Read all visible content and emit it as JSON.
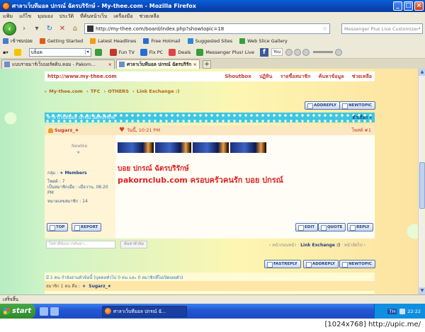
{
  "window": {
    "title": "ศาลาเว็บทีมอล ปกรณ์ ฉัตรบริรักษ์ - My-thee.com - Mozilla Firefox"
  },
  "menu": [
    "แฟ้ม",
    "แก้ไข",
    "มุมมอง",
    "ประวัติ",
    "ที่คั่นหน้าเว็บ",
    "เครื่องมือ",
    "ช่วยเหลือ"
  ],
  "nav": {
    "url": "http://my-thee.com/board/index.php?showtopic=18",
    "search_placeholder": "Messenger Plus Live Customized"
  },
  "bookmarks": [
    {
      "label": "เข้าชมบ่อย",
      "icon": "globe-icon",
      "color": "#4a7bd0"
    },
    {
      "label": "Getting Started",
      "icon": "firefox-icon",
      "color": "#e2591c"
    },
    {
      "label": "Latest Headlines",
      "icon": "rss-icon",
      "color": "#f39c12"
    },
    {
      "label": "Free Hotmail",
      "icon": "msn-icon",
      "color": "#2a6cd6"
    },
    {
      "label": "Suggested Sites",
      "icon": "ie-icon",
      "color": "#2a8ad6"
    },
    {
      "label": "Web Slice Gallery",
      "icon": "ie-icon",
      "color": "#3a9c3a"
    }
  ],
  "toolbar2": {
    "dropdown": "บล็อค",
    "items": [
      {
        "label": "Fun TV",
        "icon": "tv-icon",
        "color": "#c0392b"
      },
      {
        "label": "Fix PC",
        "icon": "wrench-icon",
        "color": "#2a6cd6"
      },
      {
        "label": "Deals",
        "icon": "tag-icon",
        "color": "#d44"
      },
      {
        "label": "Messenger Plus! Live",
        "icon": "messenger-icon",
        "color": "#3a9c3a"
      }
    ],
    "fb_label": "f",
    "tube_label": "You"
  },
  "tabs": [
    {
      "label": "แบบรายมาร์เว็บบอร์ดดิบ.คอม - Pakorn...",
      "active": false
    },
    {
      "label": "ศาลาเว็บทีมอล ปกรณ์ ฉัตรบริรักษ์",
      "active": true
    }
  ],
  "site": {
    "url": "http://www.my-thee.com",
    "nav": [
      "Shoutbox",
      "ปฏิทิน",
      "รายชื่อสมาชิก",
      "ค้นหาข้อมูล",
      "ช่วยเหลือ"
    ]
  },
  "breadcrumb": [
    "My-thee.com",
    "TFC",
    "OTHERS",
    "Link Exchange :)"
  ],
  "buttons": {
    "addreply": "ADDREPLY",
    "newtopic": "NEWTOPIC",
    "fastreply": "FASTREPLY",
    "top": "TOP",
    "report": "REPORT",
    "edit": "EDIT",
    "quote": "QUOTE",
    "reply": "REPLY"
  },
  "topic": {
    "title": "ศาลาเว็บทีมอล ปกรณ์ ฉัตรบริรักษ์",
    "options": "ตัวเลือก ▾"
  },
  "post": {
    "author": "Sugarz_★",
    "time": "วันนี้, 10:21 PM",
    "number": "โพสต์ #1",
    "rank": "Newbie",
    "rank_star": "★",
    "group_label": "กลุ่ม :",
    "group_value": "Members",
    "posts_label": "โพสต์ : 7",
    "joined": "เป็นสมาชิกเมื่อ : เมื่อวาน, 08:20 PM",
    "member_no": "หมายเลขสมาชิก : 14",
    "signature_line1": "บอย ปกรณ์ ฉัตรบริรักษ์",
    "signature_line2": "pakornclub.com ครอบครัวคนรัก บอย ปกรณ์"
  },
  "quick_search": {
    "placeholder": "ใส่คำที่ต้องการค้นหา...",
    "button": "ค้นหาหัวข้อ"
  },
  "page_nav": {
    "prev": "‹ หน้าก่อนหน้า",
    "forum": "Link Exchange :)",
    "next": "หน้าถัดไป ›"
  },
  "online": {
    "summary": "มี 1 คน กำลังอ่านหัวข้อนี้ (บุคคลทั่วไป 0 คน และ 0 สมาชิกที่ไม่เปิดเผยตัว)",
    "members_label": "สมาชิก 1 คน คือ :",
    "member": "Sugarz_★"
  },
  "status": "เสร็จสิ้น",
  "taskbar": {
    "start": "start",
    "task": "ศาลาเว็บทีมอล ปกรณ์ ฉั...",
    "lang": "TH",
    "clock": "22:22"
  },
  "watermark": "[1024x768] http://upic.me/"
}
